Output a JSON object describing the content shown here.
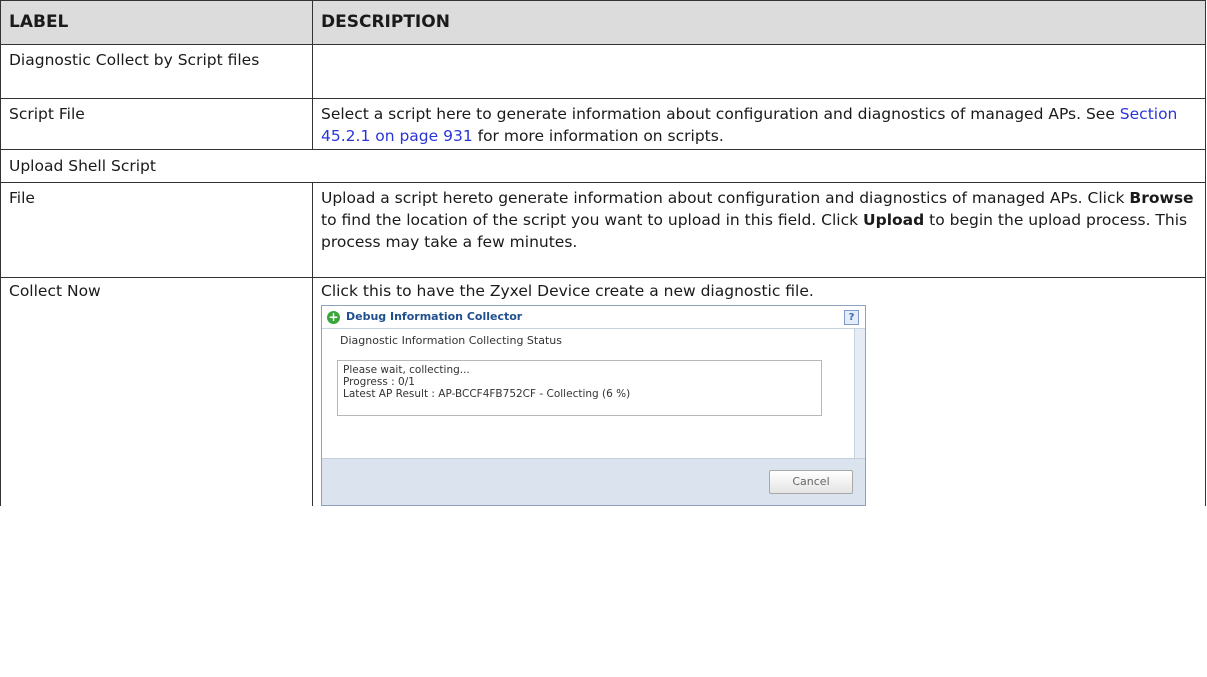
{
  "table": {
    "header": {
      "label": "LABEL",
      "description": "DESCRIPTION"
    },
    "rows": [
      {
        "label": "Diagnostic Collect by Script files",
        "description": ""
      },
      {
        "label": "Script File",
        "description_before": "Select a script here to generate information about configuration and diagnostics of managed APs. See ",
        "link": "Section 45.2.1 on page 931",
        "description_after": " for more information on scripts."
      },
      {
        "label": "Upload Shell Script"
      },
      {
        "label": "File",
        "d1": "Upload a script hereto generate information about configuration and diagnostics of managed APs. Click ",
        "browse": "Browse",
        "d2": " to find the location of the script you want to upload in this field. Click ",
        "upload": "Upload",
        "d3": " to begin the upload process. This process may take a few minutes."
      },
      {
        "label": "Collect Now",
        "description": "Click this to have the Zyxel Device create a new diagnostic file."
      }
    ]
  },
  "dialog": {
    "title": "Debug Information Collector",
    "help_icon": "?",
    "status_heading": "Diagnostic Information Collecting Status",
    "status_lines": [
      "Please wait, collecting...",
      "Progress : 0/1",
      "Latest AP Result : AP-BCCF4FB752CF - Collecting (6 %)"
    ],
    "cancel_label": "Cancel"
  }
}
